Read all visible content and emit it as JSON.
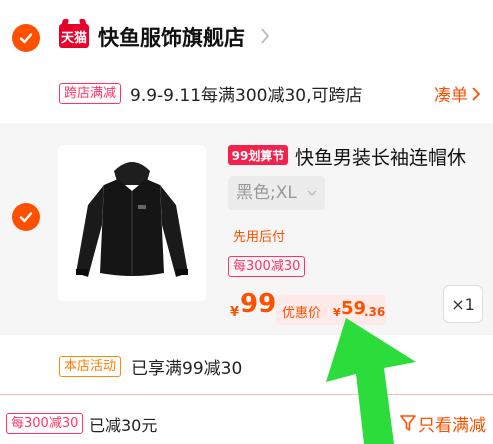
{
  "store": {
    "logo_text": "天猫",
    "name": "快鱼服饰旗舰店",
    "selected": true
  },
  "cross_store_promo": {
    "tag": "跨店满减",
    "text": "9.9-9.11每满300减30,可跨店",
    "link": "凑单"
  },
  "product": {
    "selected": true,
    "promo_badge": "99划算节",
    "title": "快鱼男装长袖连帽休",
    "sku": "黑色;XL",
    "pay_later": "先用后付",
    "coupon": "每300减30",
    "price_currency": "¥",
    "price": "99",
    "deal_label": "优惠价",
    "deal_currency": "¥",
    "deal_int": "59",
    "deal_dec": ".36",
    "quantity": "×1"
  },
  "store_activity": {
    "tag": "本店活动",
    "text": "已享满99减30"
  },
  "bottom_bar": {
    "tag": "每300减30",
    "text": "已减30元",
    "filter_label": "只看满减"
  },
  "colors": {
    "accent": "#ff5000",
    "tmall_red": "#e8002d",
    "promo_pink": "#f3224c",
    "card_bg": "#f6f6f6",
    "arrow_green": "#2bdc3a"
  }
}
